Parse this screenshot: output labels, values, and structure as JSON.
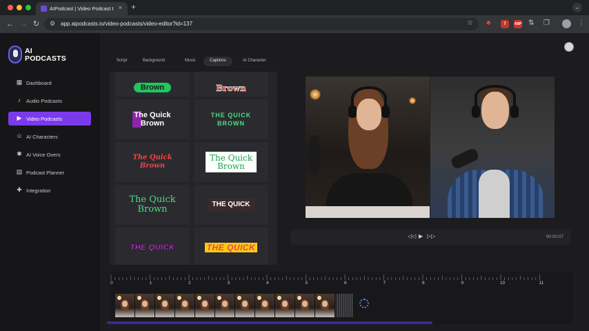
{
  "browser": {
    "tab_title": "AIPodcast | Video Podcast E...",
    "tab_close": "×",
    "new_tab": "+",
    "url": "app.aipodcasts.io/video-podcasts/video-editor?id=137",
    "ext_badge": "7",
    "ext_text": "ABP"
  },
  "brand": {
    "line1": "AI",
    "line2": "PODCASTS"
  },
  "sidebar": {
    "items": [
      {
        "label": "Dashboard",
        "icon": "dashboard-icon"
      },
      {
        "label": "Audio Podcasts",
        "icon": "microphone-icon"
      },
      {
        "label": "Video Podcasts",
        "icon": "video-camera-icon",
        "active": true
      },
      {
        "label": "AI Characters",
        "icon": "user-icon"
      },
      {
        "label": "AI Voice Overs",
        "icon": "voice-icon"
      },
      {
        "label": "Podcast Planner",
        "icon": "calendar-icon"
      },
      {
        "label": "Integration",
        "icon": "puzzle-icon"
      }
    ]
  },
  "editor_tabs": [
    "Script",
    "Background",
    "Music",
    "Captions",
    "AI Character"
  ],
  "active_tab": "Captions",
  "captions": [
    {
      "text": "Brown",
      "style": "green-pill"
    },
    {
      "text": "Brown",
      "style": "red-outline"
    },
    {
      "text": "The Quick\nBrown",
      "style": "purple-highlight"
    },
    {
      "text": "THE QUICK\nBROWN",
      "style": "green-white-caps"
    },
    {
      "text": "The Quick\nBrown",
      "style": "red-white-script"
    },
    {
      "text": "The Quick\nBrown",
      "style": "white-box-green"
    },
    {
      "text": "The Quick\nBrown",
      "style": "green-serif"
    },
    {
      "text": "THE QUICK",
      "style": "white-dark-box"
    },
    {
      "text": "THE QUICK",
      "style": "magenta-comic"
    },
    {
      "text": "THE QUICK",
      "style": "red-yellow-comic"
    }
  ],
  "player": {
    "timecode": "00:00:07"
  },
  "timeline": {
    "ticks": [
      "0",
      "1",
      "2",
      "3",
      "4",
      "5",
      "6",
      "7",
      "8",
      "9",
      "10",
      "11"
    ],
    "clip_count": 11
  },
  "colors": {
    "accent": "#7c3aed",
    "panel": "#252528",
    "background": "#1c1c1f"
  }
}
